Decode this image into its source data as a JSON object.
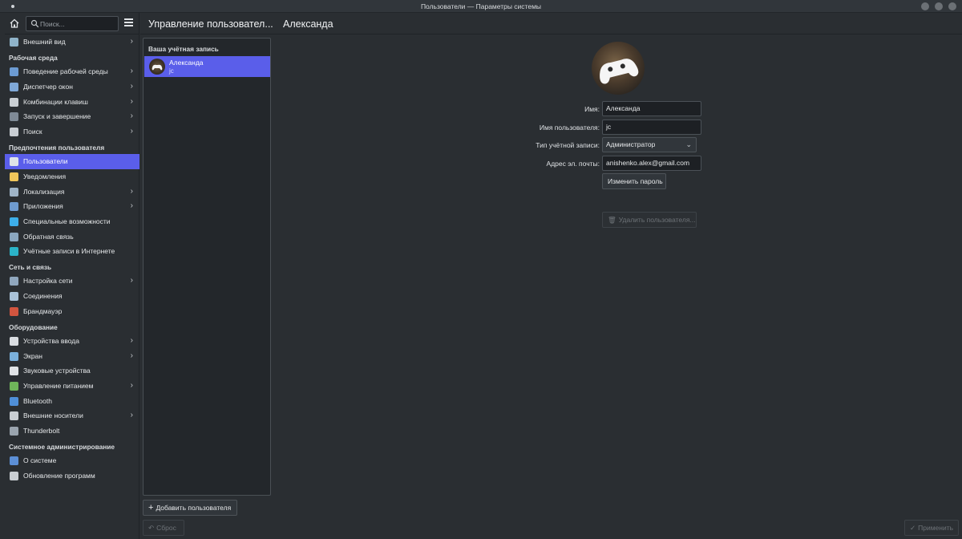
{
  "window": {
    "title": "Пользователи — Параметры системы"
  },
  "search": {
    "placeholder": "Поиск..."
  },
  "header": {
    "section_title": "Управление пользовател...",
    "page_title": "Александа"
  },
  "sidebar": {
    "groups": [
      {
        "category": "",
        "items": [
          {
            "label": "Внешний вид",
            "chevron": true,
            "icon": "appearance-icon",
            "color": "#8fb3c9"
          }
        ]
      },
      {
        "category": "Рабочая среда",
        "items": [
          {
            "label": "Поведение рабочей среды",
            "chevron": true,
            "icon": "workspace-icon",
            "color": "#6c9bd2"
          },
          {
            "label": "Диспетчер окон",
            "chevron": true,
            "icon": "window-manager-icon",
            "color": "#7fa8d8"
          },
          {
            "label": "Комбинации клавиш",
            "chevron": true,
            "icon": "keyboard-icon",
            "color": "#c9ced3"
          },
          {
            "label": "Запуск и завершение",
            "chevron": true,
            "icon": "startup-icon",
            "color": "#7f8a96"
          },
          {
            "label": "Поиск",
            "chevron": true,
            "icon": "search-settings-icon",
            "color": "#c9ced3"
          }
        ]
      },
      {
        "category": "Предпочтения пользователя",
        "items": [
          {
            "label": "Пользователи",
            "chevron": false,
            "active": true,
            "icon": "users-icon",
            "color": "#dfe3e8"
          },
          {
            "label": "Уведомления",
            "chevron": false,
            "icon": "notifications-icon",
            "color": "#f0c65a"
          },
          {
            "label": "Локализация",
            "chevron": true,
            "icon": "localization-icon",
            "color": "#9fb4c7"
          },
          {
            "label": "Приложения",
            "chevron": true,
            "icon": "applications-icon",
            "color": "#6e9bd0"
          },
          {
            "label": "Специальные возможности",
            "chevron": false,
            "icon": "accessibility-icon",
            "color": "#3daee9"
          },
          {
            "label": "Обратная связь",
            "chevron": false,
            "icon": "feedback-icon",
            "color": "#8aa6bf"
          },
          {
            "label": "Учётные записи в Интернете",
            "chevron": false,
            "icon": "online-accounts-icon",
            "color": "#2bb3c8"
          }
        ]
      },
      {
        "category": "Сеть и связь",
        "items": [
          {
            "label": "Настройка сети",
            "chevron": true,
            "icon": "network-icon",
            "color": "#8fa6bd"
          },
          {
            "label": "Соединения",
            "chevron": false,
            "icon": "connections-icon",
            "color": "#a9c2d8"
          },
          {
            "label": "Брандмауэр",
            "chevron": false,
            "icon": "firewall-icon",
            "color": "#d2553f"
          }
        ]
      },
      {
        "category": "Оборудование",
        "items": [
          {
            "label": "Устройства ввода",
            "chevron": true,
            "icon": "input-devices-icon",
            "color": "#d9dde1"
          },
          {
            "label": "Экран",
            "chevron": true,
            "icon": "display-icon",
            "color": "#7ab0dc"
          },
          {
            "label": "Звуковые устройства",
            "chevron": false,
            "icon": "audio-icon",
            "color": "#e0e3e6"
          },
          {
            "label": "Управление питанием",
            "chevron": true,
            "icon": "power-icon",
            "color": "#6fb65a"
          },
          {
            "label": "Bluetooth",
            "chevron": false,
            "icon": "bluetooth-icon",
            "color": "#4f8fd8"
          },
          {
            "label": "Внешние носители",
            "chevron": true,
            "icon": "removable-media-icon",
            "color": "#c9ced3"
          },
          {
            "label": "Thunderbolt",
            "chevron": false,
            "icon": "thunderbolt-icon",
            "color": "#9aa4ae"
          }
        ]
      },
      {
        "category": "Системное администрирование",
        "items": [
          {
            "label": "О системе",
            "chevron": false,
            "icon": "info-icon",
            "color": "#5c8fd6"
          },
          {
            "label": "Обновление программ",
            "chevron": false,
            "icon": "software-update-icon",
            "color": "#c9ced3"
          }
        ]
      }
    ]
  },
  "user_list": {
    "section_header": "Ваша учётная запись",
    "users": [
      {
        "name": "Александа",
        "login": "jc",
        "selected": true
      }
    ]
  },
  "form": {
    "name_label": "Имя:",
    "name_value": "Александа",
    "username_label": "Имя пользователя:",
    "username_value": "jc",
    "account_type_label": "Тип учётной записи:",
    "account_type_value": "Администратор",
    "email_label": "Адрес эл. почты:",
    "email_value": "anishenko.alex@gmail.com",
    "change_password": "Изменить пароль",
    "delete_user": "Удалить пользователя..."
  },
  "buttons": {
    "add_user": "Добавить пользователя",
    "reset": "Сброс",
    "apply": "Применить"
  },
  "colors": {
    "accent": "#5a5eea",
    "background": "#2a2e32"
  }
}
